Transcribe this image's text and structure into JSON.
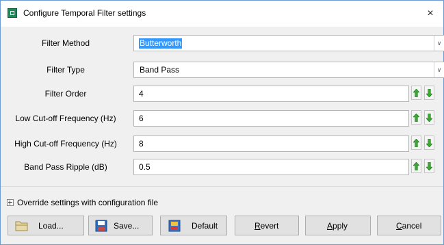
{
  "window": {
    "title": "Configure Temporal Filter settings",
    "close_glyph": "×"
  },
  "form": {
    "filter_method": {
      "label": "Filter Method",
      "value": "Butterworth"
    },
    "filter_type": {
      "label": "Filter Type",
      "value": "Band Pass"
    },
    "filter_order": {
      "label": "Filter Order",
      "value": "4"
    },
    "low_cutoff": {
      "label": "Low Cut-off Frequency (Hz)",
      "value": "6"
    },
    "high_cutoff": {
      "label": "High Cut-off Frequency (Hz)",
      "value": "8"
    },
    "ripple": {
      "label": "Band Pass Ripple (dB)",
      "value": "0.5"
    }
  },
  "override": {
    "label": "Override settings with configuration file"
  },
  "buttons": {
    "load": "Load...",
    "save": "Save...",
    "default": "Default",
    "revert_u": "R",
    "revert_rest": "evert",
    "apply_u": "A",
    "apply_rest": "pply",
    "cancel_u": "C",
    "cancel_rest": "ancel"
  },
  "icons": {
    "app": "app-icon",
    "close": "close-icon",
    "dropdown": "chevron-down-icon",
    "increment": "arrow-up-icon",
    "decrement": "arrow-down-icon",
    "load": "folder-icon",
    "save": "floppy-disk-icon",
    "default": "default-settings-icon"
  },
  "colors": {
    "selection": "#3399ff",
    "arrow_green": "#3fa535",
    "window_bg": "#f0f0f0"
  }
}
